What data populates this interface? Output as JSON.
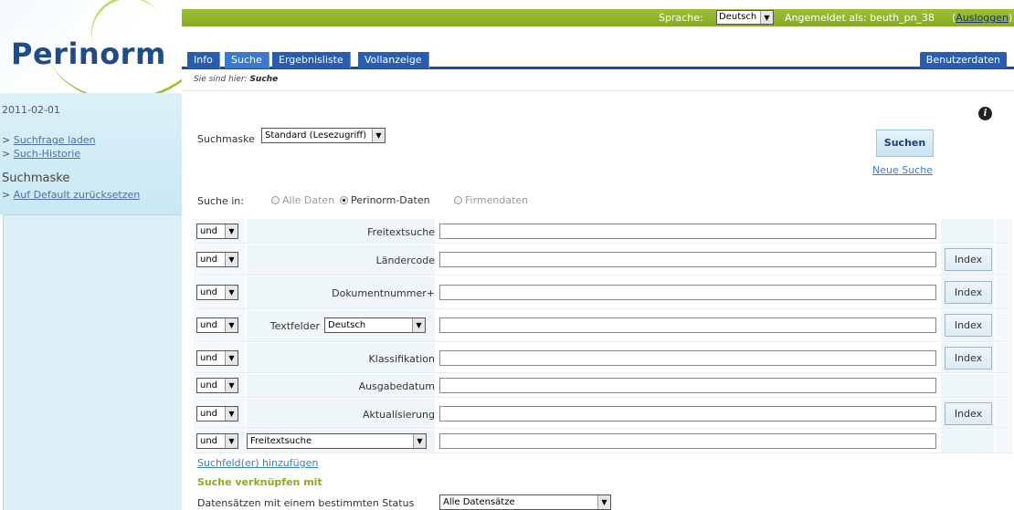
{
  "app": {
    "logo": "Perinorm"
  },
  "sidebar": {
    "date": "2011-02-01",
    "links": [
      {
        "prefix": "> ",
        "label": "Suchfrage laden"
      },
      {
        "prefix": "> ",
        "label": "Such-Historie"
      }
    ],
    "section_heading": "Suchmaske",
    "reset_link": {
      "prefix": "> ",
      "label": "Auf Default zurücksetzen"
    }
  },
  "topbar": {
    "language_label": "Sprache:",
    "language_value": "Deutsch",
    "logged_in_label": "Angemeldet als: beuth_pn_38",
    "logout_open": "(",
    "logout_label": "Ausloggen",
    "logout_close": ")"
  },
  "tabs": [
    {
      "label": "Info",
      "active": false
    },
    {
      "label": "Suche",
      "active": true
    },
    {
      "label": "Ergebnisliste",
      "active": false
    },
    {
      "label": "Vollanzeige",
      "active": false
    }
  ],
  "user_data_tab": "Benutzerdaten",
  "breadcrumb": {
    "prefix": "Sie sind hier:",
    "current": "Suche"
  },
  "search_form": {
    "mask_label": "Suchmaske",
    "mask_value": "Standard (Lesezugriff)",
    "search_button": "Suchen",
    "new_search": "Neue Suche",
    "search_in_label": "Suche in:",
    "search_in_options": [
      {
        "label": "Alle Daten",
        "checked": false,
        "disabled": true
      },
      {
        "label": "Perinorm-Daten",
        "checked": true,
        "disabled": false
      },
      {
        "label": "Firmendaten",
        "checked": false,
        "disabled": true
      }
    ],
    "rows": [
      {
        "operator": "und",
        "label": "Freitextsuche",
        "value": "",
        "index": null
      },
      {
        "operator": "und",
        "label": "Ländercode",
        "value": "",
        "index": "Index"
      },
      {
        "operator": "und",
        "label": "Dokumentnummer+",
        "value": "",
        "index": "Index"
      },
      {
        "operator": "und",
        "label": "Textfelder",
        "select_value": "Deutsch",
        "value": "",
        "index": "Index"
      },
      {
        "operator": "und",
        "label": "Klassifikation",
        "value": "",
        "index": "Index"
      },
      {
        "operator": "und",
        "label": "Ausgabedatum",
        "value": "",
        "index": null
      },
      {
        "operator": "und",
        "label": "Aktualisierung",
        "value": "",
        "index": "Index"
      },
      {
        "operator": "und",
        "select_value": "Freitextsuche",
        "value": "",
        "index": null
      }
    ],
    "add_fields": "Suchfeld(er) hinzufügen",
    "link_heading": "Suche verknüpfen mit",
    "status_label": "Datensätzen mit einem bestimmten Status",
    "status_value": "Alle Datensätze"
  },
  "colors": {
    "topbar_green": "#8fb22c",
    "tab_blue": "#2a5db0",
    "logo_blue": "#1f4b86",
    "link_blue": "#3a7bc8",
    "heading_green": "#8aaa28"
  }
}
